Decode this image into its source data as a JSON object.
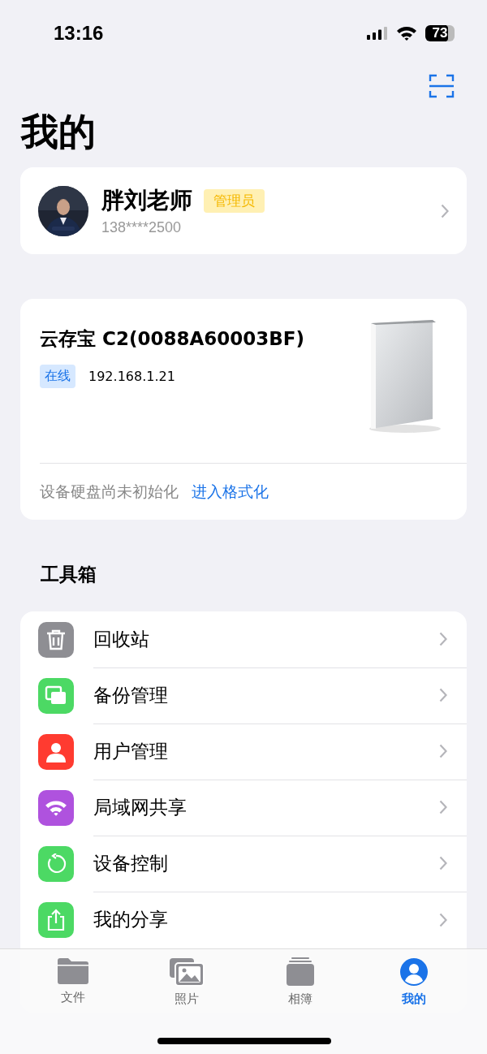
{
  "status_bar": {
    "time": "13:16",
    "battery": "73"
  },
  "title": "我的",
  "profile": {
    "name": "胖刘老师",
    "role": "管理员",
    "phone": "138****2500"
  },
  "device": {
    "name": "云存宝 C2(0088A60003BF)",
    "status": "在线",
    "ip": "192.168.1.21",
    "notice": "设备硬盘尚未初始化",
    "action": "进入格式化"
  },
  "toolbox": {
    "title": "工具箱",
    "items": [
      {
        "label": "回收站",
        "color": "#8e8e93"
      },
      {
        "label": "备份管理",
        "color": "#4cd964"
      },
      {
        "label": "用户管理",
        "color": "#ff3b30"
      },
      {
        "label": "局域网共享",
        "color": "#af52de"
      },
      {
        "label": "设备控制",
        "color": "#4cd964"
      },
      {
        "label": "我的分享",
        "color": "#4cd964"
      }
    ]
  },
  "tabs": [
    {
      "label": "文件",
      "selected": false
    },
    {
      "label": "照片",
      "selected": false
    },
    {
      "label": "相簿",
      "selected": false
    },
    {
      "label": "我的",
      "selected": true
    }
  ]
}
